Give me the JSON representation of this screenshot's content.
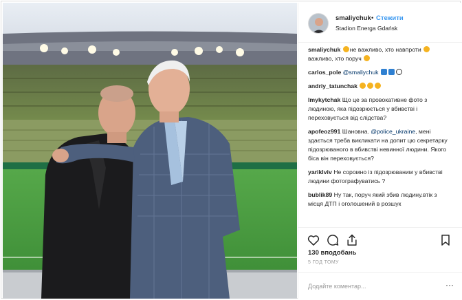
{
  "post": {
    "username": "smaliychuk",
    "separator": "•",
    "follow_label": "Стежити",
    "location": "Stadion Energa Gdańsk",
    "likes": "130 вподобань",
    "time": "5 год тому",
    "comment_placeholder": "Додайте коментар...",
    "more_label": "···"
  },
  "comments": [
    {
      "user": "smaliychuk",
      "emoji_before": "yellow",
      "text": "не важливо, хто навпроти",
      "emoji_after": "yellow",
      "text2": "важливо, хто поруч",
      "emoji_end": "yellow"
    },
    {
      "user": "carlos_pole",
      "mention": "@smaliychuk",
      "emojis": [
        "blue",
        "blue",
        "ball"
      ]
    },
    {
      "user": "andriy_tatunchak",
      "emojis": [
        "yellow",
        "yellow",
        "yellow"
      ]
    },
    {
      "user": "lmykytchak",
      "text": "Що це за провокативне фото з людиною, яка підозрюється у вбивстві і переховується від слідства?"
    },
    {
      "user": "apofeoz991",
      "text": "Шановна.",
      "mention": "@police_ukraine",
      "text2": ", мені здається треба викликати на допит цю секретарку підозрюваного в вбивстві невинної людини. Якого біса він переховується?"
    },
    {
      "user": "yariklviv",
      "text": "Не соромно із підозрюваним у вбивстві людини фотографуватись ?"
    },
    {
      "user": "bublik89",
      "text": "Ну так, поруч який збив людину.втік з місця ДТП і оголошений в розшук"
    }
  ],
  "icons": {
    "like": "heart-icon",
    "comment": "comment-icon",
    "share": "share-icon",
    "save": "bookmark-icon"
  },
  "colors": {
    "link_blue": "#3897f0",
    "mention_blue": "#003569",
    "text": "#262626",
    "muted": "#999999"
  }
}
